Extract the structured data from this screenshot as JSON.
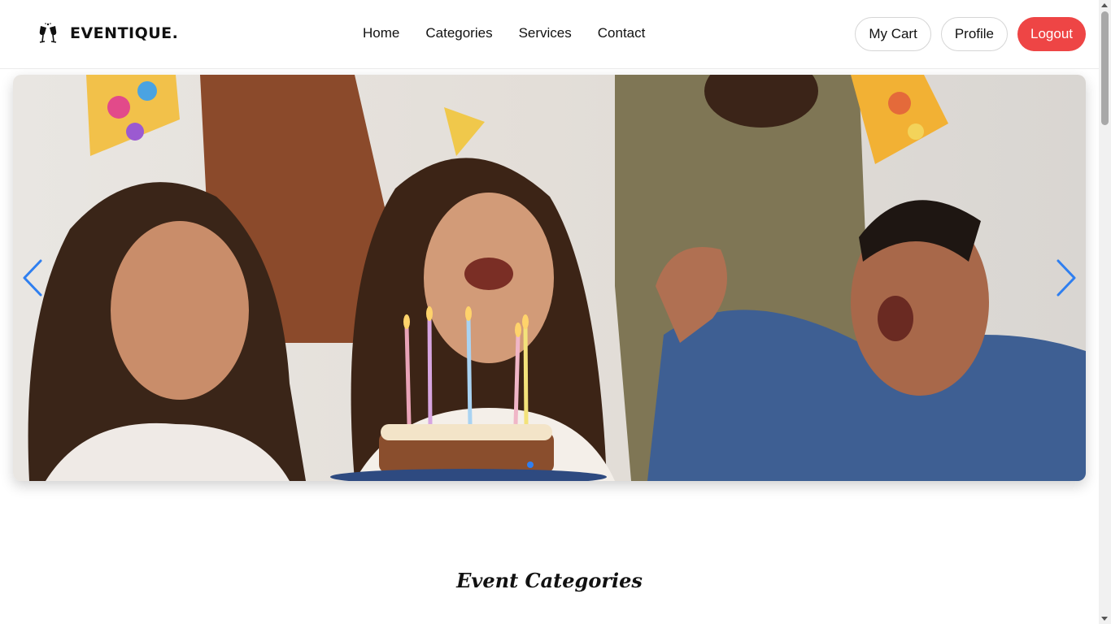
{
  "brand": {
    "name": "EVENTIQUE.",
    "logo_icon": "champagne-glasses-icon"
  },
  "nav": {
    "links": [
      {
        "label": "Home"
      },
      {
        "label": "Categories"
      },
      {
        "label": "Services"
      },
      {
        "label": "Contact"
      }
    ],
    "actions": {
      "cart": "My Cart",
      "profile": "Profile",
      "logout": "Logout"
    }
  },
  "hero": {
    "image": "birthday-party-photo",
    "prev_icon": "chevron-left-icon",
    "next_icon": "chevron-right-icon",
    "active_slide": 1,
    "slide_count": 1
  },
  "sections": {
    "categories_title": "Event Categories"
  },
  "colors": {
    "accent": "#2f7ff0",
    "logout": "#ee4545",
    "text": "#111111"
  }
}
